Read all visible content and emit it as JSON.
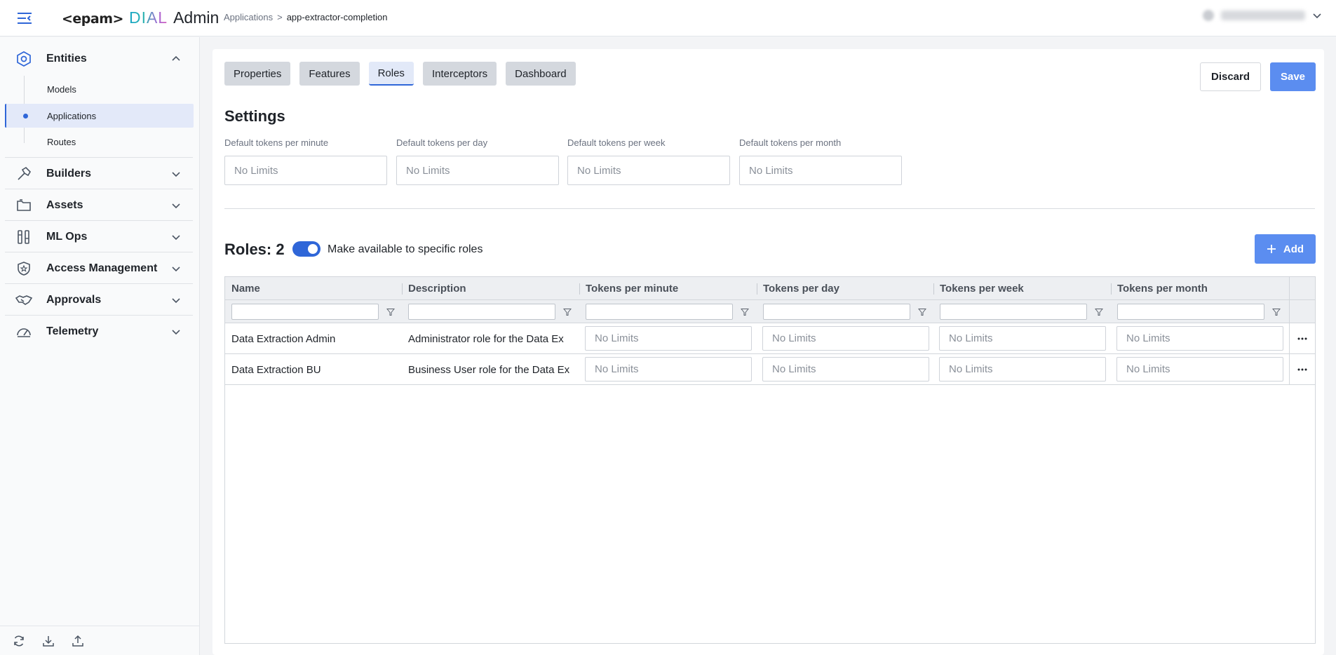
{
  "header": {
    "logo_epam": "<epam>",
    "logo_dial": "DIAL",
    "logo_admin": "Admin",
    "breadcrumb_parent": "Applications",
    "breadcrumb_separator": ">",
    "breadcrumb_current": "app-extractor-completion"
  },
  "sidebar": {
    "groups": [
      {
        "label": "Entities",
        "icon": "hexagon-icon",
        "expanded": true
      },
      {
        "label": "Builders",
        "icon": "hammer-icon",
        "expanded": false
      },
      {
        "label": "Assets",
        "icon": "folder-icon",
        "expanded": false
      },
      {
        "label": "ML Ops",
        "icon": "ml-ops-icon",
        "expanded": false
      },
      {
        "label": "Access Management",
        "icon": "shield-star-icon",
        "expanded": false
      },
      {
        "label": "Approvals",
        "icon": "handshake-icon",
        "expanded": false
      },
      {
        "label": "Telemetry",
        "icon": "gauge-icon",
        "expanded": false
      }
    ],
    "entities_items": [
      {
        "label": "Models",
        "active": false
      },
      {
        "label": "Applications",
        "active": true
      },
      {
        "label": "Routes",
        "active": false
      }
    ]
  },
  "tabs": [
    {
      "label": "Properties",
      "active": false
    },
    {
      "label": "Features",
      "active": false
    },
    {
      "label": "Roles",
      "active": true
    },
    {
      "label": "Interceptors",
      "active": false
    },
    {
      "label": "Dashboard",
      "active": false
    }
  ],
  "actions": {
    "discard_label": "Discard",
    "save_label": "Save"
  },
  "settings": {
    "title": "Settings",
    "fields": [
      {
        "label": "Default tokens per minute",
        "placeholder": "No Limits"
      },
      {
        "label": "Default tokens per day",
        "placeholder": "No Limits"
      },
      {
        "label": "Default tokens per week",
        "placeholder": "No Limits"
      },
      {
        "label": "Default tokens per month",
        "placeholder": "No Limits"
      }
    ]
  },
  "roles": {
    "title_prefix": "Roles:",
    "count": "2",
    "toggle_on": true,
    "toggle_label": "Make available to specific roles",
    "add_label": "Add"
  },
  "table": {
    "columns": [
      "Name",
      "Description",
      "Tokens per minute",
      "Tokens per day",
      "Tokens per week",
      "Tokens per month"
    ],
    "rows": [
      {
        "name": "Data Extraction Admin",
        "description": "Administrator role for the Data Ex",
        "limits": [
          "No Limits",
          "No Limits",
          "No Limits",
          "No Limits"
        ]
      },
      {
        "name": "Data Extraction BU",
        "description": "Business User role for the Data Ex",
        "limits": [
          "No Limits",
          "No Limits",
          "No Limits",
          "No Limits"
        ]
      }
    ]
  },
  "colors": {
    "accent": "#2f66d8",
    "primary_button": "#5b8df0",
    "active_nav_bg": "#e3e9f9"
  }
}
